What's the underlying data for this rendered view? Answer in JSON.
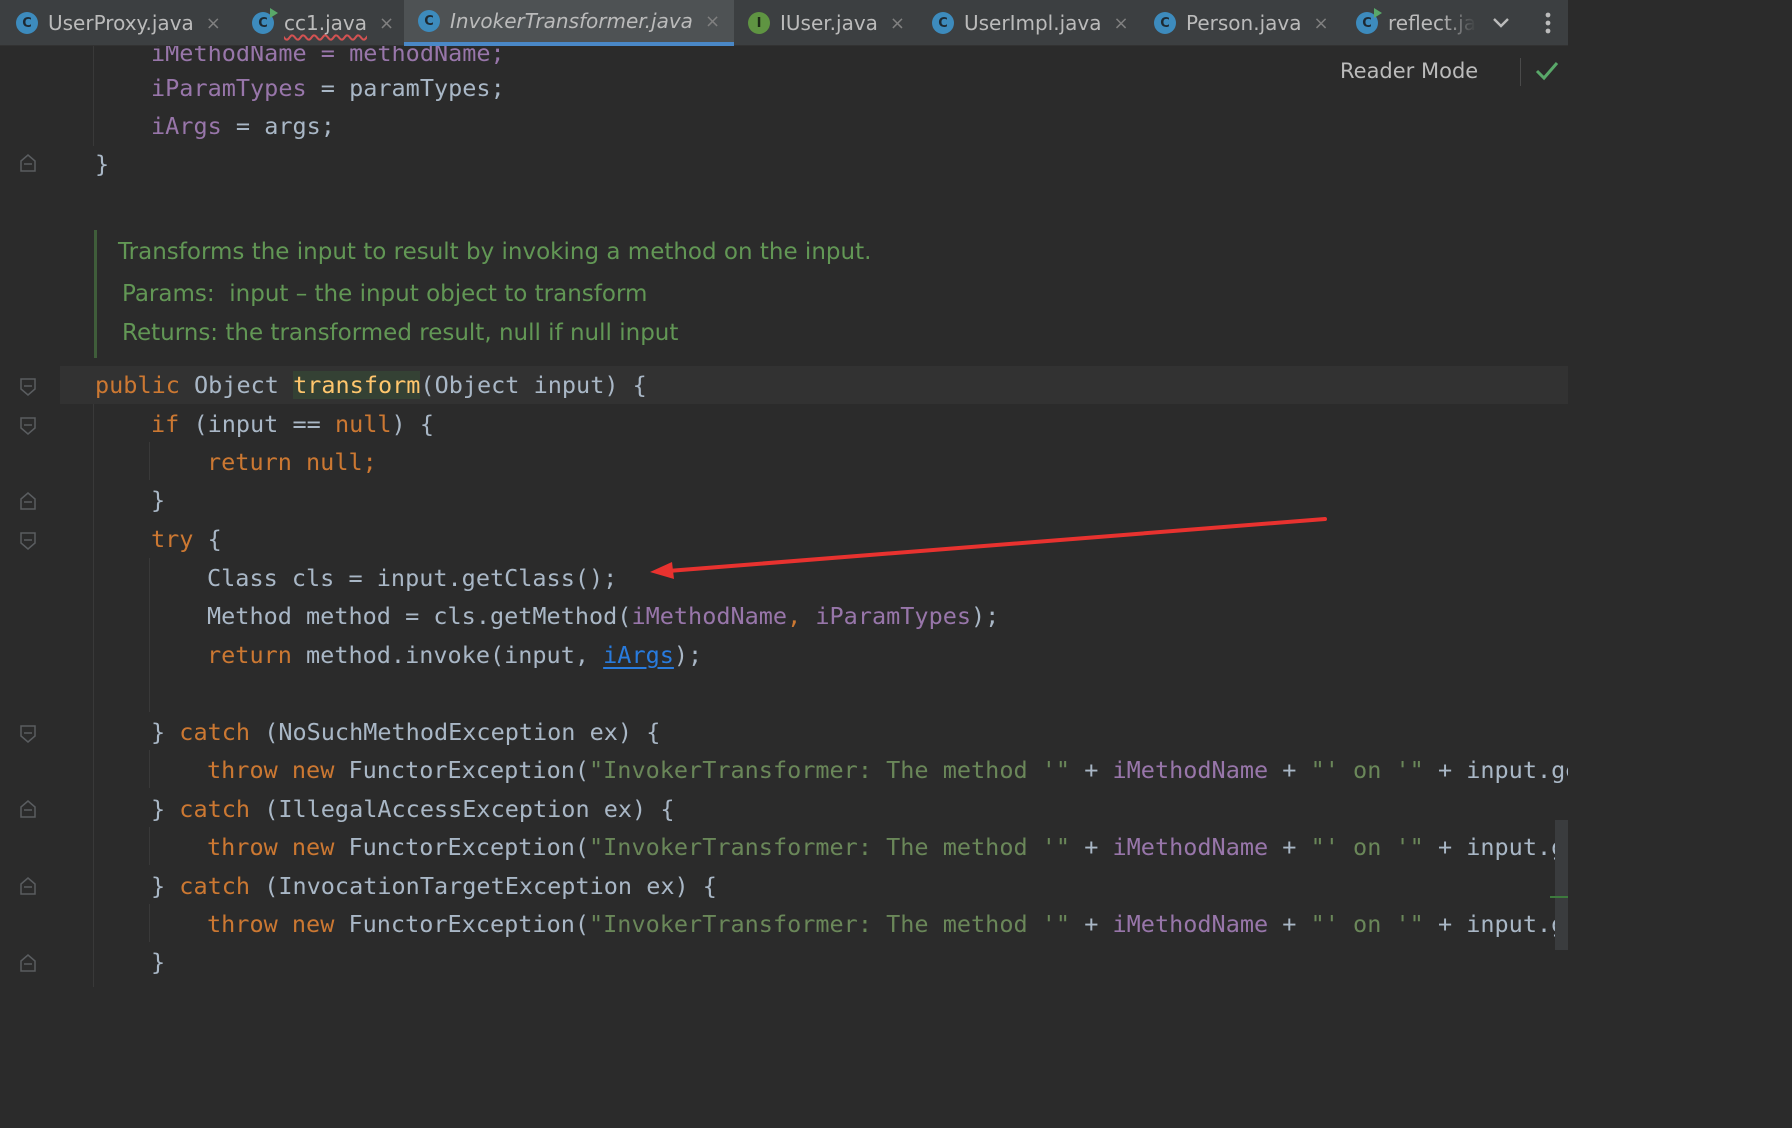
{
  "tabs": [
    {
      "label": "UserProxy.java",
      "icon": "C"
    },
    {
      "label": "cc1.java",
      "icon": "C"
    },
    {
      "label": "InvokerTransformer.java",
      "icon": "C"
    },
    {
      "label": "IUser.java",
      "icon": "I"
    },
    {
      "label": "UserImpl.java",
      "icon": "C"
    },
    {
      "label": "Person.java",
      "icon": "C"
    },
    {
      "label": "reflect.ja",
      "icon": "C"
    }
  ],
  "active_tab": "InvokerTransformer.java",
  "tab_close_glyph": "×",
  "reader_mode_label": "Reader Mode",
  "doc": {
    "summary": "Transforms the input to result by invoking a method on the input.",
    "params_label": "Params:",
    "params_text": "input – the input object to transform",
    "returns_label": "Returns:",
    "returns_text": "the transformed result, null if null input"
  },
  "code": {
    "l0": "iMethodName = methodName;",
    "l1_field": "iParamTypes",
    "l1_rest": " = paramTypes;",
    "l2_field": "iArgs",
    "l2_rest": " = args;",
    "l3": "}",
    "sig_kw": "public",
    "sig_type": " Object ",
    "sig_name": "transform",
    "sig_rest": "(Object input) {",
    "if_kw": "if",
    "if_rest1": " (input == ",
    "null_kw": "null",
    "if_rest2": ") {",
    "return_kw": "return",
    "return_null": " null;",
    "close": "}",
    "try_kw": "try",
    "try_rest": " {",
    "cls_line": "Class cls = input.getClass();",
    "method_pre": "Method method = cls.getMethod(",
    "method_f1": "iMethodName",
    "method_mid": ", ",
    "method_f2": "iParamTypes",
    "method_end": ");",
    "ret2_kw": "return",
    "ret2_pre": " method.invoke(input, ",
    "ret2_link": "iArgs",
    "ret2_end": ");",
    "catch_close": "} ",
    "catch_kw": "catch",
    "catch1_rest": " (NoSuchMethodException ex) {",
    "catch2_rest": " (IllegalAccessException ex) {",
    "catch3_rest": " (InvocationTargetException ex) {",
    "throw_kw": "throw",
    "new_kw": " new",
    "throw_type": " FunctorException(",
    "throw_str1": "\"InvokerTransformer: The method '\"",
    "throw_plus1": " + ",
    "throw_field": "iMethodName",
    "throw_plus2": " + ",
    "throw_str2": "\"' on '\"",
    "throw_tail": " + input.get"
  }
}
